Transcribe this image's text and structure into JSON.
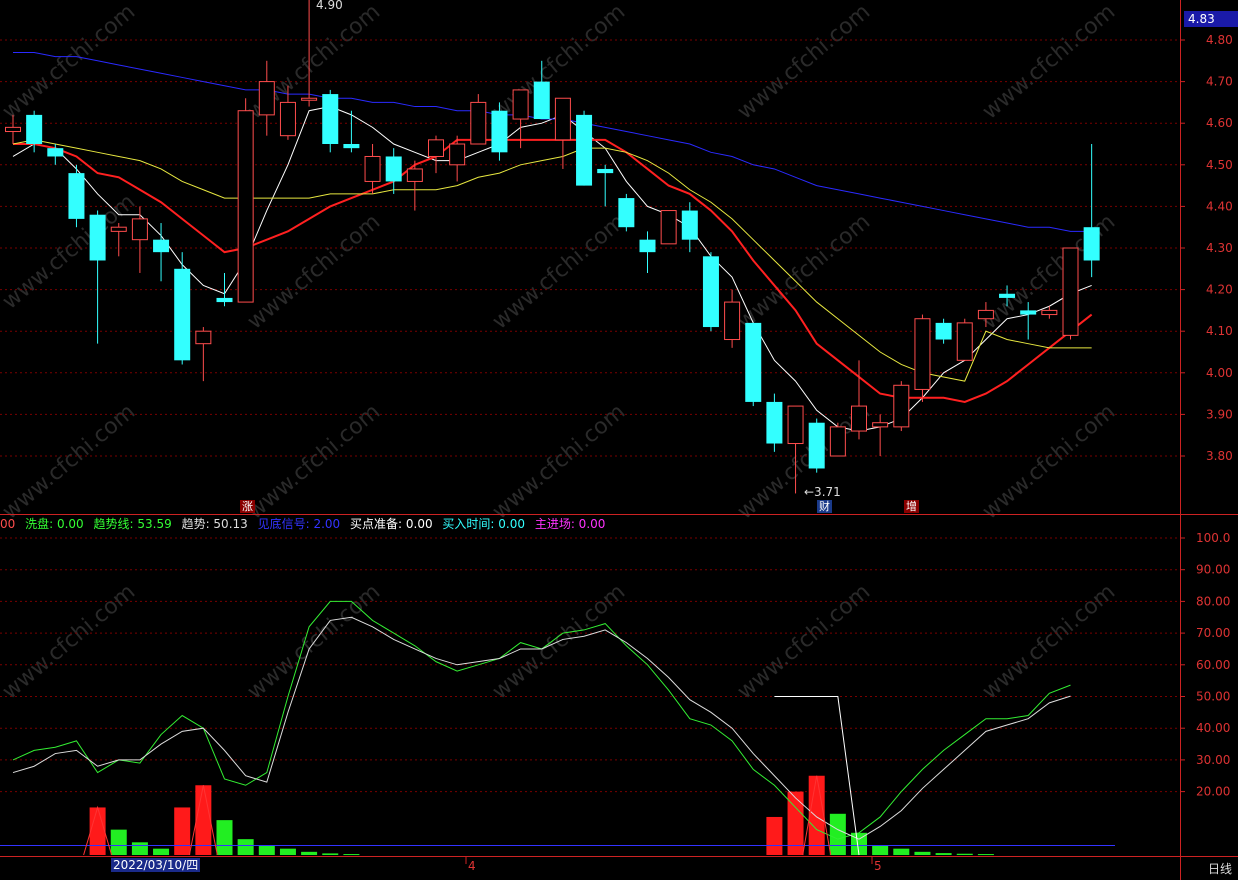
{
  "colors": {
    "up": "#ff4d4d",
    "down": "#33ffff",
    "ma5": "#ffffff",
    "ma10": "#ff2020",
    "ma20": "#e8e840",
    "ma60": "#2a2aff",
    "grid": "#7a0000",
    "axis": "#cc2222"
  },
  "header": {
    "last_price": "4.83",
    "high_label": "4.90",
    "low_label": "←3.71",
    "period": "日线",
    "date_cursor": "2022/03/10/四",
    "month_labels": [
      "4",
      "5"
    ]
  },
  "markers": {
    "zhang": "涨",
    "cai": "财",
    "zeng": "增"
  },
  "indicator_legend": [
    {
      "label": "洗盘: 0.00",
      "color": "#33ff33"
    },
    {
      "label": "趋势线: 53.59",
      "color": "#33ff33"
    },
    {
      "label": "趋势: 50.13",
      "color": "#dddddd"
    },
    {
      "label": "见底信号: 2.00",
      "color": "#3333ff"
    },
    {
      "label": "买点准备: 0.00",
      "color": "#ffffff"
    },
    {
      "label": "买入时间: 0.00",
      "color": "#33ffff"
    },
    {
      "label": "主进场: 0.00",
      "color": "#ff33ff"
    }
  ],
  "legend_prefix": "00",
  "watermark": "www.cfchi.com",
  "chart_data": [
    {
      "type": "candlestick",
      "title": "",
      "ylim": [
        3.71,
        4.86
      ],
      "yticks": [
        "4.80",
        "4.70",
        "4.60",
        "4.50",
        "4.40",
        "4.30",
        "4.20",
        "4.10",
        "4.00",
        "3.90",
        "3.80"
      ],
      "candles": [
        {
          "o": 4.58,
          "h": 4.62,
          "l": 4.55,
          "c": 4.59
        },
        {
          "o": 4.62,
          "h": 4.63,
          "l": 4.53,
          "c": 4.55
        },
        {
          "o": 4.54,
          "h": 4.55,
          "l": 4.5,
          "c": 4.52
        },
        {
          "o": 4.48,
          "h": 4.5,
          "l": 4.35,
          "c": 4.37
        },
        {
          "o": 4.38,
          "h": 4.39,
          "l": 4.07,
          "c": 4.27
        },
        {
          "o": 4.34,
          "h": 4.36,
          "l": 4.28,
          "c": 4.35
        },
        {
          "o": 4.32,
          "h": 4.4,
          "l": 4.24,
          "c": 4.37
        },
        {
          "o": 4.32,
          "h": 4.36,
          "l": 4.22,
          "c": 4.29
        },
        {
          "o": 4.25,
          "h": 4.29,
          "l": 4.02,
          "c": 4.03
        },
        {
          "o": 4.07,
          "h": 4.11,
          "l": 3.98,
          "c": 4.1
        },
        {
          "o": 4.18,
          "h": 4.24,
          "l": 4.16,
          "c": 4.17
        },
        {
          "o": 4.17,
          "h": 4.66,
          "l": 4.17,
          "c": 4.63
        },
        {
          "o": 4.62,
          "h": 4.75,
          "l": 4.57,
          "c": 4.7
        },
        {
          "o": 4.57,
          "h": 4.69,
          "l": 4.56,
          "c": 4.65
        },
        {
          "o": 4.66,
          "h": 4.9,
          "l": 4.64,
          "c": 4.66
        },
        {
          "o": 4.67,
          "h": 4.68,
          "l": 4.53,
          "c": 4.55
        },
        {
          "o": 4.55,
          "h": 4.63,
          "l": 4.53,
          "c": 4.54
        },
        {
          "o": 4.46,
          "h": 4.55,
          "l": 4.43,
          "c": 4.52
        },
        {
          "o": 4.52,
          "h": 4.54,
          "l": 4.43,
          "c": 4.46
        },
        {
          "o": 4.46,
          "h": 4.51,
          "l": 4.39,
          "c": 4.49
        },
        {
          "o": 4.52,
          "h": 4.57,
          "l": 4.48,
          "c": 4.56
        },
        {
          "o": 4.5,
          "h": 4.57,
          "l": 4.46,
          "c": 4.55
        },
        {
          "o": 4.55,
          "h": 4.67,
          "l": 4.55,
          "c": 4.65
        },
        {
          "o": 4.63,
          "h": 4.65,
          "l": 4.51,
          "c": 4.53
        },
        {
          "o": 4.61,
          "h": 4.68,
          "l": 4.54,
          "c": 4.68
        },
        {
          "o": 4.7,
          "h": 4.75,
          "l": 4.61,
          "c": 4.61
        },
        {
          "o": 4.56,
          "h": 4.66,
          "l": 4.49,
          "c": 4.66
        },
        {
          "o": 4.62,
          "h": 4.63,
          "l": 4.45,
          "c": 4.45
        },
        {
          "o": 4.49,
          "h": 4.5,
          "l": 4.4,
          "c": 4.48
        },
        {
          "o": 4.42,
          "h": 4.43,
          "l": 4.34,
          "c": 4.35
        },
        {
          "o": 4.32,
          "h": 4.34,
          "l": 4.24,
          "c": 4.29
        },
        {
          "o": 4.31,
          "h": 4.39,
          "l": 4.31,
          "c": 4.39
        },
        {
          "o": 4.39,
          "h": 4.41,
          "l": 4.29,
          "c": 4.32
        },
        {
          "o": 4.28,
          "h": 4.29,
          "l": 4.1,
          "c": 4.11
        },
        {
          "o": 4.08,
          "h": 4.2,
          "l": 4.06,
          "c": 4.17
        },
        {
          "o": 4.12,
          "h": 4.12,
          "l": 3.92,
          "c": 3.93
        },
        {
          "o": 3.93,
          "h": 3.95,
          "l": 3.81,
          "c": 3.83
        },
        {
          "o": 3.83,
          "h": 3.92,
          "l": 3.71,
          "c": 3.92
        },
        {
          "o": 3.88,
          "h": 3.89,
          "l": 3.76,
          "c": 3.77
        },
        {
          "o": 3.8,
          "h": 3.88,
          "l": 3.8,
          "c": 3.87
        },
        {
          "o": 3.86,
          "h": 4.03,
          "l": 3.84,
          "c": 3.92
        },
        {
          "o": 3.87,
          "h": 3.9,
          "l": 3.8,
          "c": 3.88
        },
        {
          "o": 3.87,
          "h": 3.98,
          "l": 3.86,
          "c": 3.97
        },
        {
          "o": 3.96,
          "h": 4.14,
          "l": 3.93,
          "c": 4.13
        },
        {
          "o": 4.12,
          "h": 4.13,
          "l": 4.07,
          "c": 4.08
        },
        {
          "o": 4.03,
          "h": 4.13,
          "l": 4.03,
          "c": 4.12
        },
        {
          "o": 4.13,
          "h": 4.17,
          "l": 4.11,
          "c": 4.15
        },
        {
          "o": 4.19,
          "h": 4.21,
          "l": 4.16,
          "c": 4.18
        },
        {
          "o": 4.15,
          "h": 4.17,
          "l": 4.08,
          "c": 4.14
        },
        {
          "o": 4.14,
          "h": 4.16,
          "l": 4.13,
          "c": 4.15
        },
        {
          "o": 4.09,
          "h": 4.3,
          "l": 4.08,
          "c": 4.3
        },
        {
          "o": 4.35,
          "h": 4.55,
          "l": 4.23,
          "c": 4.27
        }
      ],
      "series": [
        {
          "name": "",
          "color_key": "ma5",
          "values": [
            4.52,
            4.55,
            4.54,
            4.49,
            4.43,
            4.38,
            4.38,
            4.33,
            4.26,
            4.21,
            4.19,
            4.27,
            4.39,
            4.5,
            4.63,
            4.64,
            4.62,
            4.59,
            4.55,
            4.53,
            4.51,
            4.51,
            4.53,
            4.55,
            4.59,
            4.6,
            4.62,
            4.58,
            4.54,
            4.46,
            4.4,
            4.38,
            4.35,
            4.28,
            4.23,
            4.12,
            4.03,
            3.98,
            3.91,
            3.87,
            3.86,
            3.87,
            3.89,
            3.94,
            4.0,
            4.03,
            4.08,
            4.13,
            4.14,
            4.16,
            4.19,
            4.21
          ]
        },
        {
          "name": "",
          "color_key": "ma10",
          "values": [
            4.55,
            4.55,
            4.54,
            4.52,
            4.48,
            4.47,
            4.44,
            4.41,
            4.37,
            4.33,
            4.29,
            4.3,
            4.32,
            4.34,
            4.37,
            4.4,
            4.42,
            4.44,
            4.46,
            4.5,
            4.52,
            4.56,
            4.56,
            4.56,
            4.56,
            4.56,
            4.56,
            4.56,
            4.56,
            4.53,
            4.49,
            4.45,
            4.43,
            4.39,
            4.34,
            4.27,
            4.21,
            4.15,
            4.07,
            4.03,
            3.99,
            3.95,
            3.94,
            3.94,
            3.94,
            3.93,
            3.95,
            3.98,
            4.02,
            4.06,
            4.1,
            4.14
          ]
        },
        {
          "name": "",
          "color_key": "ma20",
          "values": [
            4.55,
            4.56,
            4.55,
            4.54,
            4.53,
            4.52,
            4.51,
            4.49,
            4.46,
            4.44,
            4.42,
            4.42,
            4.42,
            4.42,
            4.42,
            4.43,
            4.43,
            4.43,
            4.44,
            4.44,
            4.44,
            4.45,
            4.47,
            4.48,
            4.5,
            4.51,
            4.52,
            4.54,
            4.54,
            4.53,
            4.51,
            4.48,
            4.44,
            4.41,
            4.37,
            4.32,
            4.27,
            4.22,
            4.17,
            4.13,
            4.09,
            4.05,
            4.02,
            4.0,
            3.99,
            3.98,
            4.1,
            4.08,
            4.07,
            4.06,
            4.06,
            4.06
          ]
        },
        {
          "name": "",
          "color_key": "ma60",
          "values": [
            4.77,
            4.77,
            4.76,
            4.76,
            4.75,
            4.74,
            4.73,
            4.72,
            4.71,
            4.7,
            4.69,
            4.68,
            4.68,
            4.67,
            4.67,
            4.66,
            4.66,
            4.65,
            4.65,
            4.64,
            4.64,
            4.63,
            4.63,
            4.62,
            4.62,
            4.61,
            4.61,
            4.6,
            4.59,
            4.58,
            4.57,
            4.56,
            4.55,
            4.53,
            4.52,
            4.5,
            4.49,
            4.47,
            4.45,
            4.44,
            4.43,
            4.42,
            4.41,
            4.4,
            4.39,
            4.38,
            4.37,
            4.36,
            4.35,
            4.35,
            4.34,
            4.34
          ]
        }
      ]
    },
    {
      "type": "line",
      "title": "",
      "ylim": [
        0,
        105
      ],
      "yticks": [
        "100.0",
        "90.00",
        "80.00",
        "70.00",
        "60.00",
        "50.00",
        "40.00",
        "30.00",
        "20.00"
      ],
      "series": [
        {
          "name": "趋势线",
          "color": "#33ee33",
          "values": [
            30,
            33,
            34,
            36,
            26,
            30,
            29,
            38,
            44,
            40,
            24,
            22,
            26,
            50,
            72,
            80,
            80,
            74,
            70,
            66,
            61,
            58,
            60,
            62,
            67,
            65,
            70,
            71,
            73,
            66,
            60,
            52,
            43,
            41,
            36,
            27,
            22,
            15,
            8,
            5,
            7,
            12,
            20,
            27,
            33,
            38,
            43,
            43,
            44,
            51,
            53.59
          ]
        },
        {
          "name": "趋势",
          "color": "#dddddd",
          "values": [
            26,
            28,
            32,
            33,
            28,
            30,
            30,
            35,
            39,
            40,
            33,
            25,
            23,
            45,
            65,
            74,
            75,
            72,
            68,
            65,
            62,
            60,
            61,
            62,
            65,
            65,
            68,
            69,
            71,
            67,
            62,
            56,
            49,
            45,
            40,
            32,
            25,
            18,
            12,
            8,
            5,
            9,
            14,
            21,
            27,
            33,
            39,
            41,
            43,
            48,
            50.13
          ]
        },
        {
          "name": "见底信号",
          "color": "#ffffff",
          "values": [
            null,
            null,
            null,
            null,
            null,
            null,
            null,
            null,
            null,
            null,
            null,
            null,
            null,
            null,
            null,
            null,
            null,
            null,
            null,
            null,
            null,
            null,
            null,
            null,
            null,
            null,
            null,
            null,
            null,
            null,
            null,
            null,
            null,
            null,
            null,
            null,
            50,
            50,
            50,
            50,
            0,
            null,
            null,
            null,
            null,
            null,
            null,
            null,
            null,
            null,
            null
          ]
        }
      ],
      "bars_red": [
        {
          "i": 4,
          "v": 15
        },
        {
          "i": 8,
          "v": 15
        },
        {
          "i": 9,
          "v": 22
        },
        {
          "i": 36,
          "v": 12
        },
        {
          "i": 37,
          "v": 20
        },
        {
          "i": 38,
          "v": 25
        }
      ],
      "bars_green": [
        {
          "i": 5,
          "v": 8
        },
        {
          "i": 6,
          "v": 4
        },
        {
          "i": 7,
          "v": 2
        },
        {
          "i": 10,
          "v": 11
        },
        {
          "i": 11,
          "v": 5
        },
        {
          "i": 12,
          "v": 3
        },
        {
          "i": 13,
          "v": 2
        },
        {
          "i": 14,
          "v": 1
        },
        {
          "i": 15,
          "v": 0.5
        },
        {
          "i": 16,
          "v": 0.3
        },
        {
          "i": 39,
          "v": 13
        },
        {
          "i": 40,
          "v": 7
        },
        {
          "i": 41,
          "v": 3
        },
        {
          "i": 42,
          "v": 2
        },
        {
          "i": 43,
          "v": 1
        },
        {
          "i": 44,
          "v": 0.6
        },
        {
          "i": 45,
          "v": 0.4
        },
        {
          "i": 46,
          "v": 0.3
        }
      ],
      "baseline_value": 3
    }
  ]
}
